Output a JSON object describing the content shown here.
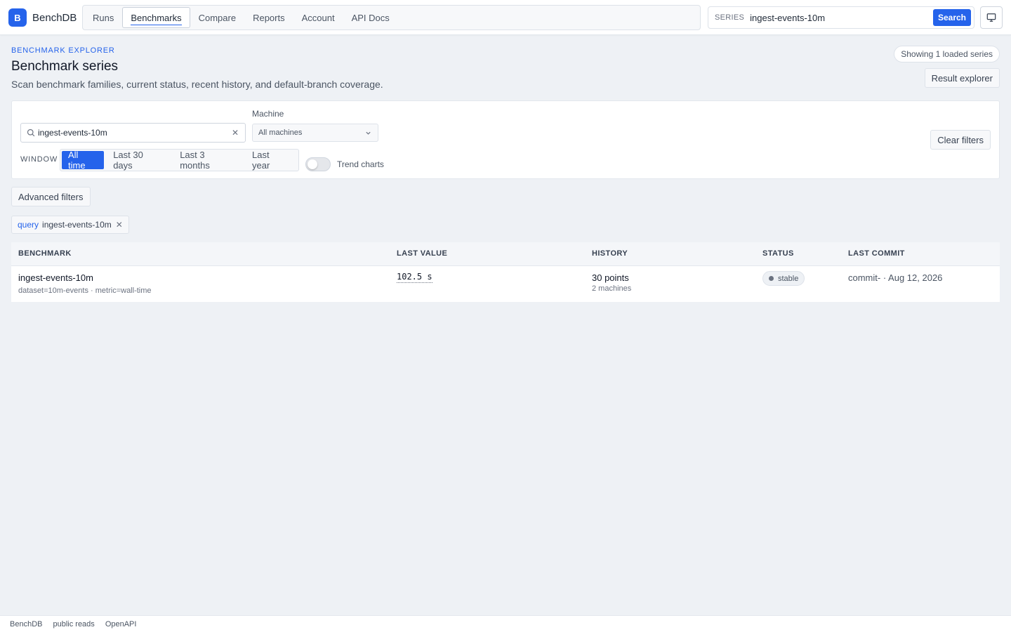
{
  "brand": {
    "logo_letter": "B",
    "name": "BenchDB",
    "accent": "#2563eb"
  },
  "nav": {
    "items": [
      {
        "label": "Runs",
        "active": false
      },
      {
        "label": "Benchmarks",
        "active": true
      },
      {
        "label": "Compare",
        "active": false
      },
      {
        "label": "Reports",
        "active": false
      },
      {
        "label": "Account",
        "active": false
      },
      {
        "label": "API Docs",
        "active": false
      }
    ]
  },
  "series_search": {
    "label": "SERIES",
    "value": "ingest-events-10m",
    "button": "Search"
  },
  "header": {
    "eyebrow": "BENCHMARK EXPLORER",
    "title": "Benchmark series",
    "subtitle": "Scan benchmark families, current status, recent history, and default-branch coverage.",
    "count_pill": "Showing 1 loaded series",
    "result_explorer": "Result explorer"
  },
  "filters": {
    "query_value": "ingest-events-10m",
    "machine_label": "Machine",
    "machine_value": "All machines",
    "window_label": "WINDOW",
    "window_options": [
      {
        "label": "All time",
        "active": true
      },
      {
        "label": "Last 30 days",
        "active": false
      },
      {
        "label": "Last 3 months",
        "active": false
      },
      {
        "label": "Last year",
        "active": false
      }
    ],
    "trend_label": "Trend charts",
    "trend_on": false,
    "clear_label": "Clear filters"
  },
  "advanced_filters": "Advanced filters",
  "active_chip": {
    "key": "query",
    "value": "ingest-events-10m"
  },
  "table": {
    "columns": [
      "BENCHMARK",
      "LAST VALUE",
      "HISTORY",
      "STATUS",
      "LAST COMMIT"
    ],
    "rows": [
      {
        "name": "ingest-events-10m",
        "meta": "dataset=10m-events · metric=wall-time",
        "last_value": "102.5 s",
        "history_points": "30 points",
        "history_machines": "2 machines",
        "status": "stable",
        "last_commit": "commit- · Aug 12, 2026"
      }
    ]
  },
  "footer": {
    "items": [
      "BenchDB",
      "public reads",
      "OpenAPI"
    ]
  }
}
